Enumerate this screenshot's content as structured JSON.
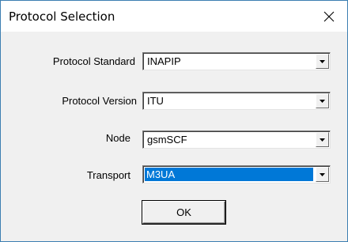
{
  "window": {
    "title": "Protocol Selection",
    "close_icon": "close-icon"
  },
  "fields": [
    {
      "label": "Protocol Standard",
      "value": "INAPIP",
      "selected": false
    },
    {
      "label": "Protocol Version",
      "value": "ITU",
      "selected": false
    },
    {
      "label": "Node",
      "value": "gsmSCF",
      "selected": false
    },
    {
      "label": "Transport",
      "value": "M3UA",
      "selected": true
    }
  ],
  "buttons": {
    "ok_label": "OK"
  },
  "colors": {
    "selection": "#0078d7",
    "window_border": "#3c7fb1",
    "dialog_bg": "#f0f0f0"
  }
}
